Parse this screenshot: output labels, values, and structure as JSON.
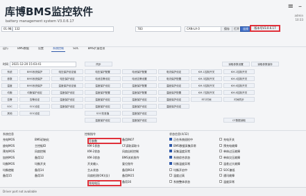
{
  "app": {
    "title": "库博BMS监控软件",
    "subtitle": "battery management system V3.0.6.17",
    "user": "admin",
    "time": "10:33"
  },
  "toolbar": {
    "port_label": "01.98.1",
    "port_value": "132",
    "baud_value": "783",
    "protocol_value": "CAN-LA 0",
    "save_label": "保存",
    "open_label": "打开",
    "connect_label": "连接",
    "version_btn": "版本号V3.0.6.17"
  },
  "tabs": [
    "运行",
    "BMS数据",
    "设置",
    "系统控制",
    "SOC",
    "BMS扩展信息"
  ],
  "time_row": {
    "label": "时间",
    "value": "2021-12-20 15:03:41",
    "sync_btn": "同步",
    "read_btns": [
      "读取参数设置",
      "读取参数保存"
    ]
  },
  "grid_rows": [
    [
      "系统",
      "BMS系统保护",
      "电压保护设定值",
      "电压保护配置",
      "电池保护配置",
      "电流保护设定",
      "KM-1控制开关",
      "KM-2控制开关"
    ],
    [
      "参数",
      "BMS系统保护",
      "电压保护设定",
      "电池告警设定",
      "电池告警设置",
      "电流保护配置",
      "KM-3控制开关",
      "KM-4控制开关"
    ],
    [
      "温度",
      "BMS系统保护",
      "温度保护设定值",
      "温度保护设定",
      "温度保护配置",
      "温度保护设定",
      "KM-5控制开关",
      "KM-6控制开关"
    ],
    [
      "均衡",
      "均衡保护设定",
      "温度保护设定",
      "温度保护配置",
      "温度保护配置",
      "温度保护配置",
      "KM-7控制开关",
      "KM-8控制开关"
    ],
    [
      "告警",
      "告警设定",
      "温度保护设定",
      "温度保护设定",
      "温度保护设定",
      "温度保护设定",
      "RTC时间",
      "时间同步"
    ],
    [
      "SOC",
      "SOC设定",
      "温度保护设定",
      "温度保护设定",
      "温度保护设定",
      "温度保护设定",
      "",
      ""
    ],
    [
      "其他",
      "SOC设定",
      "",
      "SOC校准值",
      "温度保护设定",
      "",
      "",
      ""
    ],
    [
      "",
      "",
      "",
      "温度保护设定",
      "温度保护设定",
      "",
      "",
      "CF数据读取"
    ]
  ],
  "groups": {
    "left_title": "系统信息",
    "middle_title": "控制指令",
    "right_title": "状态信息(4/32)",
    "left_items": [
      [
        "充电MOS",
        "BMS初始化"
      ],
      [
        "放电MOS",
        "主控板ID"
      ],
      [
        "预充MOS",
        "风扇控制"
      ],
      [
        "加热MOS",
        "备用12"
      ],
      [
        "均衡MOS",
        "均衡开关"
      ],
      [
        "均衡使能",
        "备用14"
      ],
      [
        "备用15",
        "备用16"
      ]
    ],
    "middle_items": [
      [
        "写参数",
        "备用IN07"
      ],
      [
        "KM-1状态",
        "CF读取读取卡"
      ],
      [
        "KM-2状态",
        "风扇自检控制"
      ],
      [
        "KM-3状态",
        "BMS关机指令"
      ],
      [
        "开关输入",
        "复位指令"
      ],
      [
        "主从状态",
        "备用IN14"
      ],
      [
        "风扇检测(OK)(反)",
        "备用IN15"
      ],
      [
        "充电电压",
        "备用16"
      ]
    ],
    "middle_checked": [
      0,
      7
    ],
    "right_items": [
      [
        "正在系统巡检中",
        "充电开关"
      ],
      [
        "BMS数据采集异常",
        "预充电故障"
      ],
      [
        "采集温度异常",
        "单体过压故障"
      ],
      [
        "系统综合状态",
        "单体欠压故障"
      ],
      [
        "均衡温度异常",
        "温差过大故障"
      ],
      [
        "均衡开启中",
        "SOC偏低"
      ],
      [
        "温度过高",
        "通讯故障"
      ],
      [
        "系统整体状态",
        "温度异常"
      ]
    ]
  },
  "status": {
    "text": "Driver port not available"
  },
  "colors": {
    "highlight": "#e0303a",
    "accent": "#2d58a8"
  }
}
